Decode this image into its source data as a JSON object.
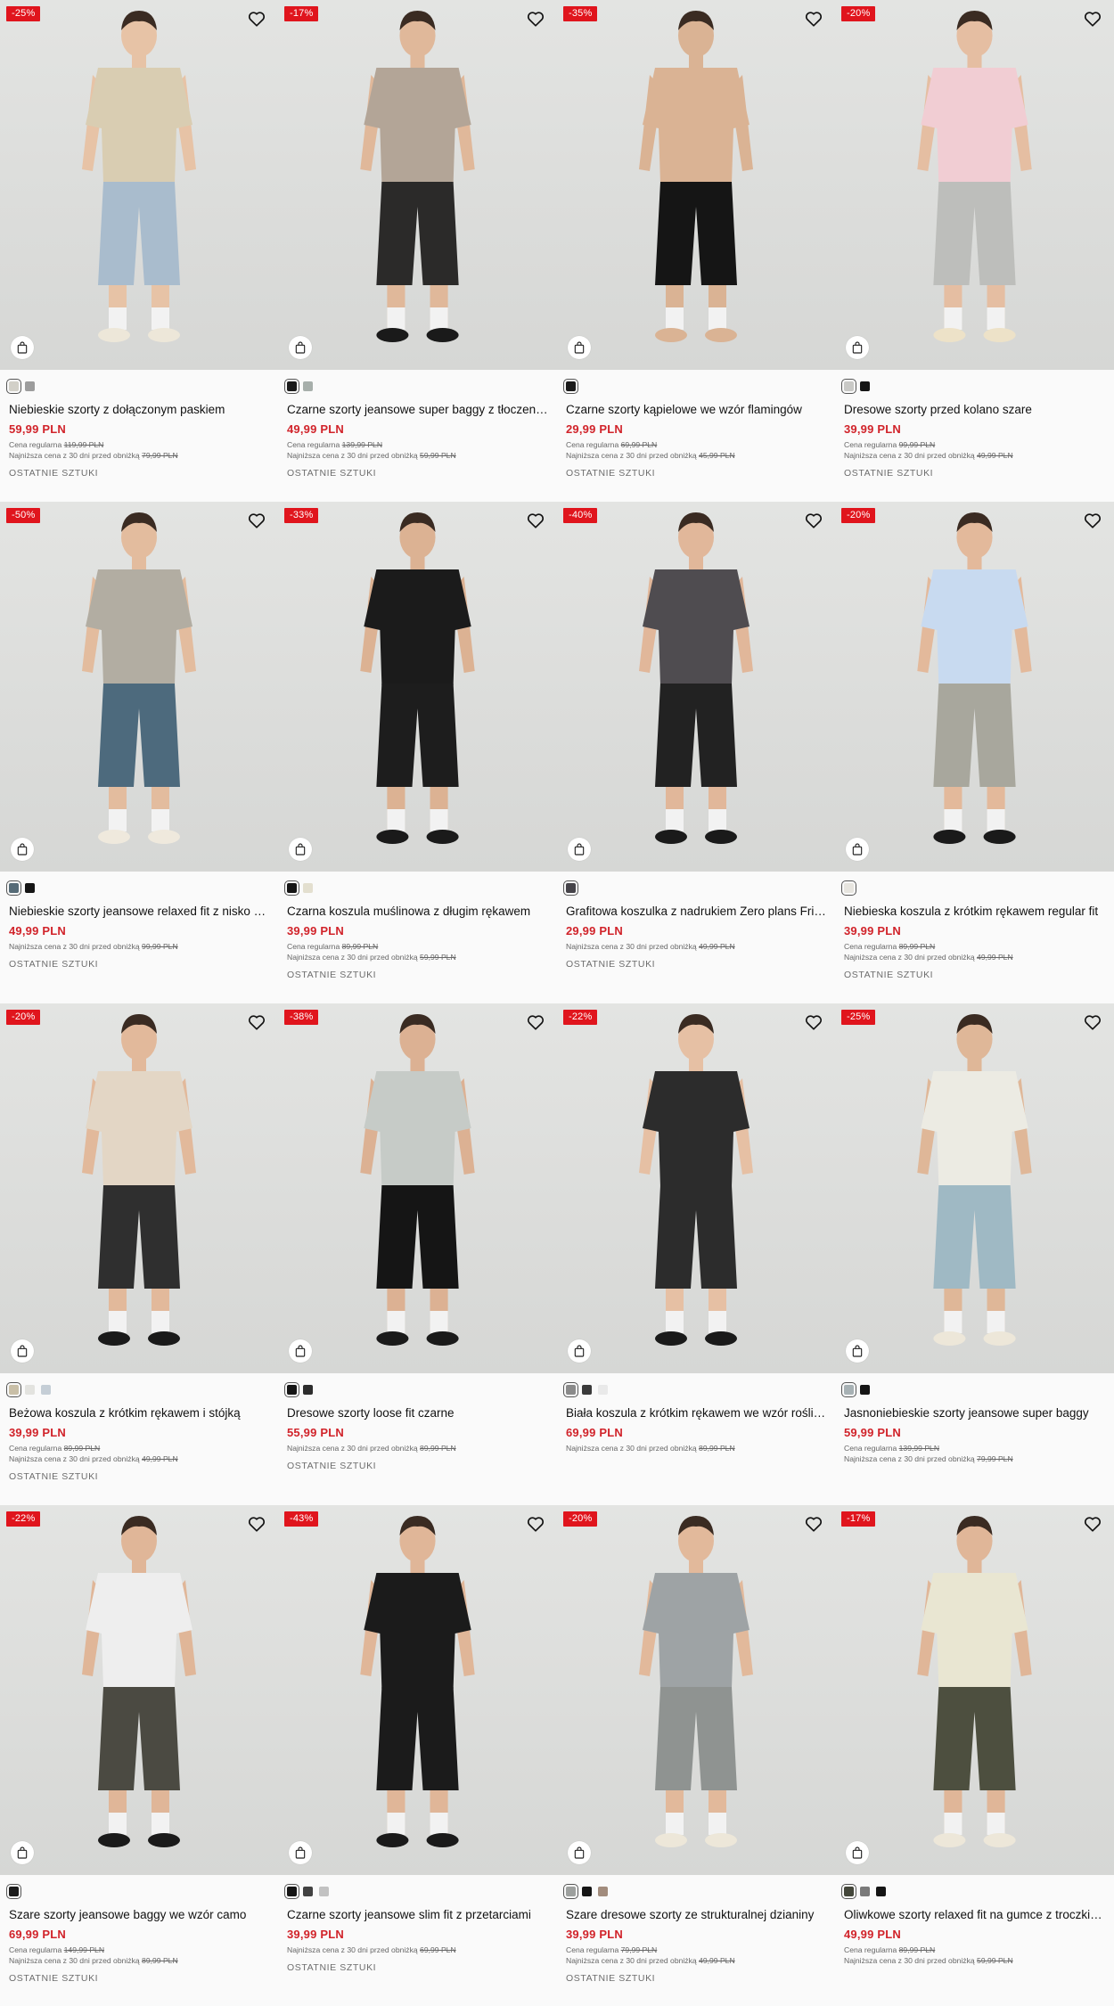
{
  "labels": {
    "regular_price": "Cena regularna",
    "lowest_price": "Najniższa cena z 30 dni przed obniżką",
    "last_items": "OSTATNIE SZTUKI"
  },
  "colors": {
    "accent_red": "#e0151d",
    "price_red": "#d1232a"
  },
  "icons": [
    "heart-icon",
    "shopping-bag-icon"
  ],
  "products": [
    {
      "discount": "-25%",
      "title": "Niebieskie szorty z dołączonym paskiem",
      "price": "59,99 PLN",
      "regular_price": "119,99 PLN",
      "lowest_price": "79,99 PLN",
      "last_items": true,
      "swatches": [
        "#d2d0c8",
        "#9c9c9c"
      ],
      "top": "#d9cdb2",
      "bottom": "#a9bccd",
      "skin": "#e7c3a6",
      "shoes": "#ede7d9"
    },
    {
      "discount": "-17%",
      "title": "Czarne szorty jeansowe super baggy z tłoczeniem",
      "price": "49,99 PLN",
      "regular_price": "139,99 PLN",
      "lowest_price": "59,99 PLN",
      "last_items": true,
      "swatches": [
        "#1b1b1b",
        "#a7afab"
      ],
      "top": "#b3a597",
      "bottom": "#2b2a29",
      "skin": "#e0b89a",
      "shoes": "#1a1a1a"
    },
    {
      "discount": "-35%",
      "title": "Czarne szorty kąpielowe we wzór flamingów",
      "price": "29,99 PLN",
      "regular_price": "69,99 PLN",
      "lowest_price": "45,99 PLN",
      "last_items": true,
      "swatches": [
        "#1b1b1b"
      ],
      "top": "#dab394",
      "bottom": "#151515",
      "skin": "#dab394",
      "shoes": "#dab394"
    },
    {
      "discount": "-20%",
      "title": "Dresowe szorty przed kolano szare",
      "price": "39,99 PLN",
      "regular_price": "99,99 PLN",
      "lowest_price": "49,99 PLN",
      "last_items": true,
      "swatches": [
        "#c9c9c6",
        "#151515"
      ],
      "top": "#f1cdd3",
      "bottom": "#bdbebb",
      "skin": "#e5bea2",
      "shoes": "#ede2c8"
    },
    {
      "discount": "-50%",
      "title": "Niebieskie szorty jeansowe relaxed fit z nisko opuszczonym krokiem",
      "price": "49,99 PLN",
      "regular_price": "",
      "lowest_price": "99,99 PLN",
      "last_items": true,
      "swatches": [
        "#566b77",
        "#151515"
      ],
      "top": "#b2ada2",
      "bottom": "#4d6a7d",
      "skin": "#e3bc9e",
      "shoes": "#efe9dd"
    },
    {
      "discount": "-33%",
      "title": "Czarna koszula muślinowa z długim rękawem",
      "price": "39,99 PLN",
      "regular_price": "89,99 PLN",
      "lowest_price": "59,99 PLN",
      "last_items": true,
      "swatches": [
        "#151515",
        "#e3dfcf"
      ],
      "top": "#1b1b1b",
      "bottom": "#1d1d1d",
      "skin": "#dcb293",
      "shoes": "#1a1a1a"
    },
    {
      "discount": "-40%",
      "title": "Grafitowa koszulka z nadrukiem Zero plans Friday",
      "price": "29,99 PLN",
      "regular_price": "",
      "lowest_price": "49,99 PLN",
      "last_items": true,
      "swatches": [
        "#46444a"
      ],
      "top": "#4f4c50",
      "bottom": "#222222",
      "skin": "#e1b79a",
      "shoes": "#1a1a1a"
    },
    {
      "discount": "-20%",
      "title": "Niebieska koszula z krótkim rękawem regular fit",
      "price": "39,99 PLN",
      "regular_price": "89,99 PLN",
      "lowest_price": "49,99 PLN",
      "last_items": true,
      "swatches": [
        "#e7e5df"
      ],
      "top": "#c8daf0",
      "bottom": "#a8a79d",
      "skin": "#e3b99b",
      "shoes": "#1a1a1a"
    },
    {
      "discount": "-20%",
      "title": "Beżowa koszula z krótkim rękawem i stójką",
      "price": "39,99 PLN",
      "regular_price": "89,99 PLN",
      "lowest_price": "49,99 PLN",
      "last_items": true,
      "swatches": [
        "#c9bfa7",
        "#e3e3df",
        "#c5ced6"
      ],
      "top": "#e3d6c5",
      "bottom": "#2f2f2f",
      "skin": "#e2b99b",
      "shoes": "#1a1a1a"
    },
    {
      "discount": "-38%",
      "title": "Dresowe szorty loose fit czarne",
      "price": "55,99 PLN",
      "regular_price": "",
      "lowest_price": "89,99 PLN",
      "last_items": true,
      "swatches": [
        "#151515",
        "#2d2d2d"
      ],
      "top": "#c6cbc7",
      "bottom": "#151515",
      "skin": "#dcb193",
      "shoes": "#1a1a1a"
    },
    {
      "discount": "-22%",
      "title": "Biała koszula z krótkim rękawem we wzór roślinny",
      "price": "69,99 PLN",
      "regular_price": "",
      "lowest_price": "89,99 PLN",
      "last_items": false,
      "swatches": [
        "#8a8a8a",
        "#3a3a3a",
        "#e9e9e9"
      ],
      "top": "#2c2c2c",
      "bottom": "#2c2c2c",
      "skin": "#e6c0a4",
      "shoes": "#1a1a1a"
    },
    {
      "discount": "-25%",
      "title": "Jasnoniebieskie szorty jeansowe super baggy",
      "price": "59,99 PLN",
      "regular_price": "139,99 PLN",
      "lowest_price": "79,99 PLN",
      "last_items": false,
      "swatches": [
        "#a7b1b4",
        "#151515"
      ],
      "top": "#ecebe3",
      "bottom": "#9fb9c4",
      "skin": "#dfb798",
      "shoes": "#ede7d9"
    },
    {
      "discount": "-22%",
      "title": "Szare szorty jeansowe baggy we wzór camo",
      "price": "69,99 PLN",
      "regular_price": "149,99 PLN",
      "lowest_price": "89,99 PLN",
      "last_items": true,
      "swatches": [
        "#1b1b1b"
      ],
      "top": "#eeeeee",
      "bottom": "#4b4a42",
      "skin": "#e0b698",
      "shoes": "#1a1a1a"
    },
    {
      "discount": "-43%",
      "title": "Czarne szorty jeansowe slim fit z przetarciami",
      "price": "39,99 PLN",
      "regular_price": "",
      "lowest_price": "69,99 PLN",
      "last_items": true,
      "swatches": [
        "#151515",
        "#424242",
        "#c2c2c2"
      ],
      "top": "#1b1b1b",
      "bottom": "#1b1b1b",
      "skin": "#e0b698",
      "shoes": "#1a1a1a"
    },
    {
      "discount": "-20%",
      "title": "Szare dresowe szorty ze strukturalnej dzianiny",
      "price": "39,99 PLN",
      "regular_price": "79,99 PLN",
      "lowest_price": "49,99 PLN",
      "last_items": true,
      "swatches": [
        "#9da09e",
        "#151515",
        "#a28c7d"
      ],
      "top": "#9ea3a5",
      "bottom": "#8f9391",
      "skin": "#e2b99b",
      "shoes": "#ede7d9"
    },
    {
      "discount": "-17%",
      "title": "Oliwkowe szorty relaxed fit na gumce z troczkiem",
      "price": "49,99 PLN",
      "regular_price": "89,99 PLN",
      "lowest_price": "59,99 PLN",
      "last_items": false,
      "swatches": [
        "#43463a",
        "#7a7a7a",
        "#151515"
      ],
      "top": "#e9e6d2",
      "bottom": "#4d4f3f",
      "skin": "#e0b698",
      "shoes": "#ede7d9"
    }
  ]
}
